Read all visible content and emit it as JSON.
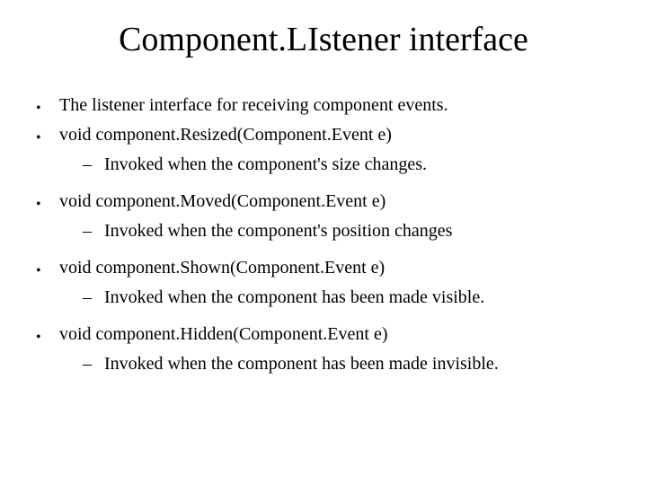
{
  "title": "Component.LIstener interface",
  "items": [
    {
      "text": "The listener interface for receiving component events.",
      "sub": []
    },
    {
      "text": "void component.Resized(Component.Event e)",
      "sub": [
        {
          "text": "Invoked when the component's size changes."
        }
      ]
    },
    {
      "text": "void component.Moved(Component.Event e)",
      "sub": [
        {
          "text": "Invoked when the component's position changes"
        }
      ]
    },
    {
      "text": "void component.Shown(Component.Event e)",
      "sub": [
        {
          "text": "Invoked when the component has been made visible."
        }
      ]
    },
    {
      "text": "void component.Hidden(Component.Event e)",
      "sub": [
        {
          "text": "Invoked when the component has been made invisible."
        }
      ]
    }
  ]
}
